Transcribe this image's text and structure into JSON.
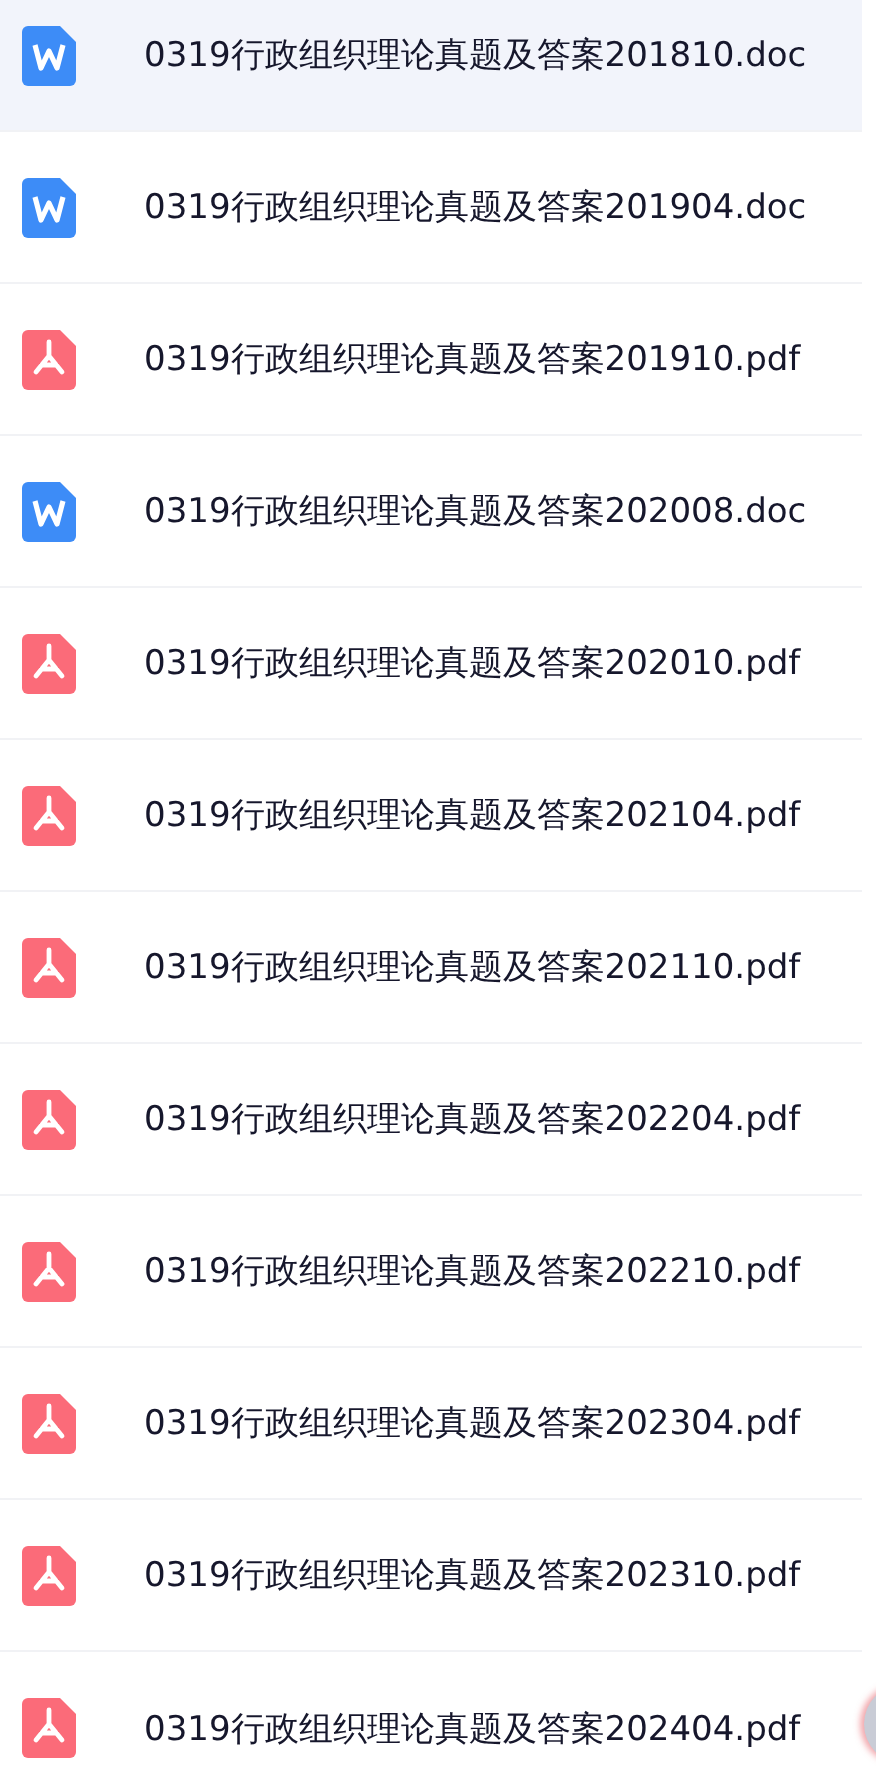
{
  "files": [
    {
      "name": "0319行政组织理论真题及答案201810.doc",
      "kind": "word",
      "selected": true
    },
    {
      "name": "0319行政组织理论真题及答案201904.doc",
      "kind": "word",
      "selected": false
    },
    {
      "name": "0319行政组织理论真题及答案201910.pdf",
      "kind": "pdf",
      "selected": false
    },
    {
      "name": "0319行政组织理论真题及答案202008.doc",
      "kind": "word",
      "selected": false
    },
    {
      "name": "0319行政组织理论真题及答案202010.pdf",
      "kind": "pdf",
      "selected": false
    },
    {
      "name": "0319行政组织理论真题及答案202104.pdf",
      "kind": "pdf",
      "selected": false
    },
    {
      "name": "0319行政组织理论真题及答案202110.pdf",
      "kind": "pdf",
      "selected": false
    },
    {
      "name": "0319行政组织理论真题及答案202204.pdf",
      "kind": "pdf",
      "selected": false
    },
    {
      "name": "0319行政组织理论真题及答案202210.pdf",
      "kind": "pdf",
      "selected": false
    },
    {
      "name": "0319行政组织理论真题及答案202304.pdf",
      "kind": "pdf",
      "selected": false
    },
    {
      "name": "0319行政组织理论真题及答案202310.pdf",
      "kind": "pdf",
      "selected": false
    },
    {
      "name": "0319行政组织理论真题及答案202404.pdf",
      "kind": "pdf",
      "selected": false
    }
  ]
}
